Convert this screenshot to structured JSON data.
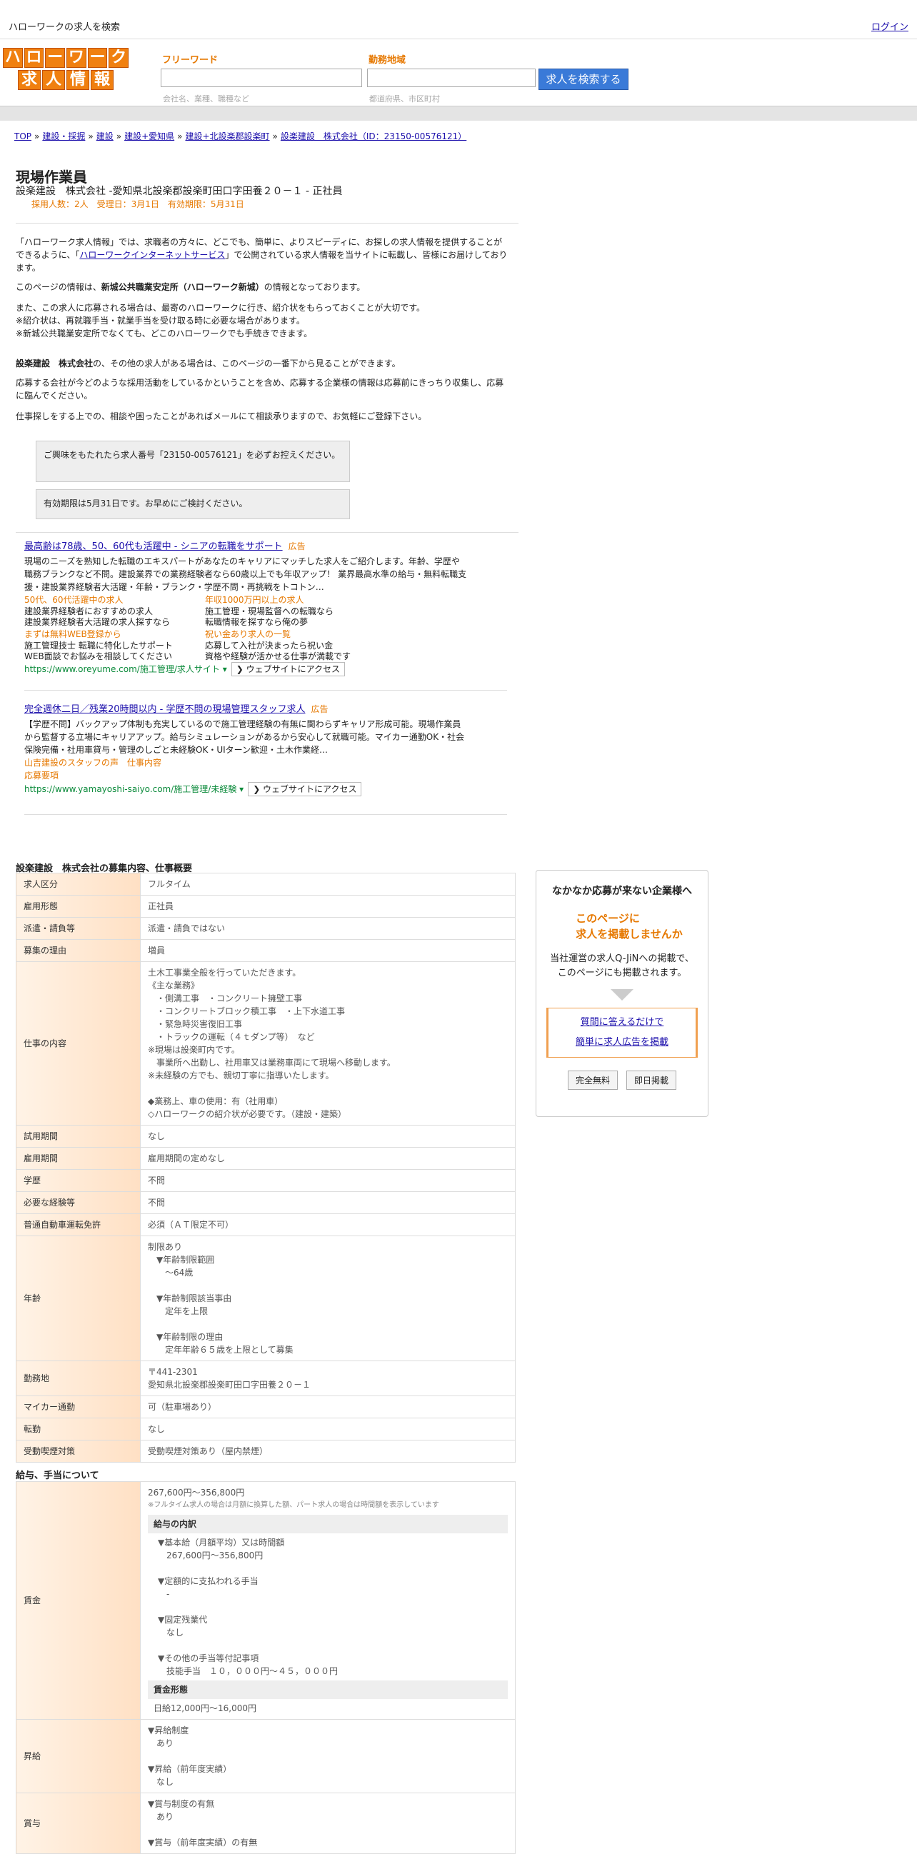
{
  "top": {
    "title": "ハローワークの求人を検索",
    "login": "ログイン"
  },
  "logo": {
    "row1": [
      "ハ",
      "ロ",
      "ー",
      "ワ",
      "ー",
      "ク"
    ],
    "row2": [
      "求",
      "人",
      "情",
      "報"
    ],
    "icon": "hellowork-logo"
  },
  "search": {
    "freeword_label": "フリーワード",
    "area_label": "勤務地域",
    "freeword_placeholder": "会社名、業種、職種など",
    "area_placeholder": "都道府県、市区町村",
    "button": "求人を検索する"
  },
  "breadcrumb": {
    "items": [
      "TOP",
      "建設・採掘",
      "建設",
      "建設+愛知県",
      "建設+北設楽郡設楽町",
      "設楽建設　株式会社（ID：23150-00576121）"
    ],
    "sep": "»"
  },
  "job": {
    "title": "現場作業員",
    "subtitle": "設楽建設　株式会社 -愛知県北設楽郡設楽町田口字田養２０－１ - 正社員",
    "meta": "採用人数：2人　受理日：3月1日　有効期限：5月31日"
  },
  "intro": {
    "p1a": "「ハローワーク求人情報」では、求職者の方々に、どこでも、簡単に、よりスピーディに、お探しの求人情報を提供することができるように、「",
    "p1link": "ハローワークインターネットサービス",
    "p1b": "」で公開されている求人情報を当サイトに転載し、皆様にお届けしております。",
    "p2a": "このページの情報は、",
    "p2b": "新城公共職業安定所（ハローワーク新城）",
    "p2c": "の情報となっております。",
    "p3": "また、この求人に応募される場合は、最寄のハローワークに行き、紹介状をもらっておくことが大切です。",
    "p4": "※紹介状は、再就職手当・就業手当を受け取る時に必要な場合があります。",
    "p5": "※新城公共職業安定所でなくても、どこのハローワークでも手続きできます。",
    "p6a": "設楽建設　株式会社",
    "p6b": "の、その他の求人がある場合は、このページの一番下から見ることができます。",
    "p7": "応募する会社が今どのような採用活動をしているかということを含め、応募する企業様の情報は応募前にきっちり収集し、応募に臨んでください。",
    "p8": "仕事探しをする上での、相談や困ったことがあればメールにて相談承りますので、お気軽にご登録下さい。"
  },
  "notices": {
    "n1": "ご興味をもたれたら求人番号「23150-00576121」を必ずお控えください。",
    "n2": "有効期限は5月31日です。お早めにご検討ください。"
  },
  "ads": [
    {
      "title": "最高齢は78歳、50、60代も活躍中 - シニアの転職をサポート",
      "tag": "広告",
      "desc": "現場のニーズを熟知した転職のエキスパートがあなたのキャリアにマッチした求人をご紹介します。年齢、学歴や職務ブランクなど不問。建設業界での業務経験者なら60歳以上でも年収アップ！ 業界最高水準の給与・無料転職支援・建設業界経験者大活躍・年齢・ブランク・学歴不問・再挑戦をトコトン…",
      "grid": [
        {
          "o": "50代、60代活躍中の求人",
          "t": "建設業界経験者におすすめの求人\n建設業界経験者大活躍の求人探すなら"
        },
        {
          "o": "年収1000万円以上の求人",
          "t": "施工管理・現場監督への転職なら\n転職情報を探すなら俺の夢"
        },
        {
          "o": "まずは無料WEB登録から",
          "t": "施工管理技士 転職に特化したサポート\nWEB面談でお悩みを相談してください"
        },
        {
          "o": "祝い金あり求人の一覧",
          "t": "応募して入社が決まったら祝い金\n資格や経験が活かせる仕事が満載です"
        }
      ],
      "url": "https://www.oreyume.com/施工管理/求人サイト",
      "visit": "❯ ウェブサイトにアクセス"
    },
    {
      "title": "完全週休二日／残業20時間以内 - 学歴不問の現場管理スタッフ求人",
      "tag": "広告",
      "desc": "【学歴不問】バックアップ体制も充実しているので施工管理経験の有無に関わらずキャリア形成可能。現場作業員から監督する立場にキャリアアップ。給与シミュレーションがあるから安心して就職可能。マイカー通勤OK・社会保険完備・社用車貸与・管理のしごと未経験OK・UIターン歓迎・土木作業経…",
      "links": [
        "山吉建設のスタッフの声",
        "仕事内容",
        "応募要項"
      ],
      "url": "https://www.yamayoshi-saiyo.com/施工管理/未経験",
      "visit": "❯ ウェブサイトにアクセス"
    }
  ],
  "details": {
    "title": "設楽建設　株式会社の募集内容、仕事概要",
    "rows": [
      {
        "h": "求人区分",
        "v": "フルタイム"
      },
      {
        "h": "雇用形態",
        "v": "正社員"
      },
      {
        "h": "派遣・請負等",
        "v": "派遣・請負ではない"
      },
      {
        "h": "募集の理由",
        "v": "増員"
      },
      {
        "h": "仕事の内容",
        "v": "土木工事業全般を行っていただきます。\n《主な業務》\n　・側溝工事　・コンクリート擁壁工事\n　・コンクリートブロック積工事　・上下水道工事\n　・緊急時災害復旧工事\n　・トラックの運転（４ｔダンプ等）　など\n※現場は設楽町内です。\n　事業所へ出勤し、社用車又は業務車両にて現場へ移動します。\n※未経験の方でも、親切丁寧に指導いたします。\n\n◆業務上、車の使用：有（社用車）\n◇ハローワークの紹介状が必要です。（建設・建築）"
      },
      {
        "h": "試用期間",
        "v": "なし"
      },
      {
        "h": "雇用期間",
        "v": "雇用期間の定めなし"
      },
      {
        "h": "学歴",
        "v": "不問"
      },
      {
        "h": "必要な経験等",
        "v": "不問"
      },
      {
        "h": "普通自動車運転免許",
        "v": "必須（ＡＴ限定不可）"
      },
      {
        "h": "年齢",
        "v": "制限あり\n　▼年齢制限範囲\n　　〜64歳\n\n　▼年齢制限該当事由\n　　定年を上限\n\n　▼年齢制限の理由\n　　定年年齢６５歳を上限として募集"
      },
      {
        "h": "勤務地",
        "v": "〒441-2301\n愛知県北設楽郡設楽町田口字田養２０－１"
      },
      {
        "h": "マイカー通勤",
        "v": "可（駐車場あり）"
      },
      {
        "h": "転勤",
        "v": "なし"
      },
      {
        "h": "受動喫煙対策",
        "v": "受動喫煙対策あり（屋内禁煙）"
      }
    ]
  },
  "salary": {
    "title": "給与、手当について",
    "wage_label": "賃金",
    "wage_range": "267,600円〜356,800円",
    "wage_note": "※フルタイム求人の場合は月額に換算した額、パート求人の場合は時間額を表示しています",
    "breakdown_head": "給与の内訳",
    "breakdown": "▼基本給（月額平均）又は時間額\n　267,600円〜356,800円\n\n▼定額的に支払われる手当\n　-\n\n▼固定残業代\n　なし\n\n▼その他の手当等付記事項\n　技能手当　１０，０００円〜４５，０００円",
    "form_head": "賃金形態",
    "form": "日給12,000円〜16,000円",
    "raise_label": "昇給",
    "raise": "▼昇給制度\n　あり\n\n▼昇給（前年度実績）\n　なし",
    "bonus_label": "賞与",
    "bonus": "▼賞与制度の有無\n　あり\n\n▼賞与（前年度実績）の有無"
  },
  "side": {
    "s1": "なかなか応募が来ない企業様へ",
    "s2a": "このページに",
    "s2b": "求人を掲載しませんか",
    "s3a": "当社運営の求人Q-JiNへの掲載で、",
    "s3b": "このページにも掲載されます。",
    "l1": "質問に答えるだけで",
    "l2": "簡単に求人広告を掲載",
    "b1": "完全無料",
    "b2": "即日掲載"
  }
}
